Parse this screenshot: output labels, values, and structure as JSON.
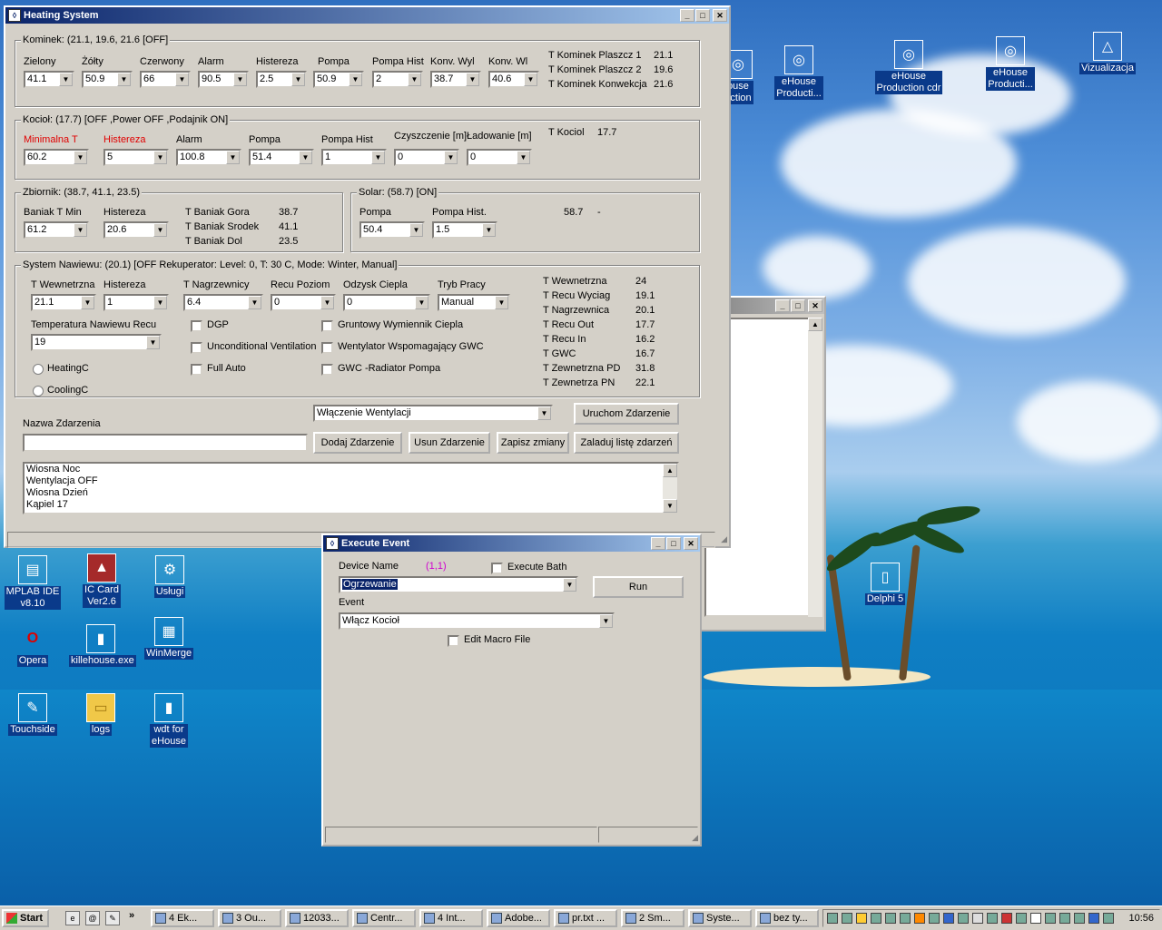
{
  "desktop_icons": [
    {
      "label": "ouse\nuction",
      "glyph": "◎"
    },
    {
      "label": "eHouse\nProducti...",
      "glyph": "◎"
    },
    {
      "label": "eHouse\nProduction cdr",
      "glyph": "◎"
    },
    {
      "label": "eHouse\nProducti...",
      "glyph": "◎"
    },
    {
      "label": "Vizualizacja",
      "glyph": "△"
    },
    {
      "label": "MPLAB IDE\nv8.10",
      "glyph": "▤"
    },
    {
      "label": "IC Card\nVer2.6",
      "glyph": "▲"
    },
    {
      "label": "Usługi",
      "glyph": "⚙"
    },
    {
      "label": "Opera",
      "glyph": "O"
    },
    {
      "label": "killehouse.exe",
      "glyph": "▮"
    },
    {
      "label": "WinMerge",
      "glyph": "▦"
    },
    {
      "label": "Touchside",
      "glyph": "✎"
    },
    {
      "label": "logs",
      "glyph": "▭"
    },
    {
      "label": "wdt for\neHouse",
      "glyph": "▮"
    },
    {
      "label": "Delphi 5",
      "glyph": "▯"
    }
  ],
  "heating": {
    "title": "Heating System",
    "kominek": {
      "group": "Kominek: (21.1, 19.6, 21.6 [OFF]",
      "fields": [
        {
          "label": "Zielony",
          "value": "41.1"
        },
        {
          "label": "Żółty",
          "value": "50.9"
        },
        {
          "label": "Czerwony",
          "value": "66"
        },
        {
          "label": "Alarm",
          "value": "90.5"
        },
        {
          "label": "Histereza",
          "value": "2.5"
        },
        {
          "label": "Pompa",
          "value": "50.9"
        },
        {
          "label": "Pompa Hist",
          "value": "2"
        },
        {
          "label": "Konv. Wyl",
          "value": "38.7"
        },
        {
          "label": "Konv. Wl",
          "value": "40.6"
        }
      ],
      "readouts": [
        {
          "label": "T Kominek Plaszcz 1",
          "value": "21.1"
        },
        {
          "label": "T Kominek Plaszcz 2",
          "value": "19.6"
        },
        {
          "label": "T Kominek Konwekcja",
          "value": "21.6"
        }
      ]
    },
    "kociol": {
      "group": "Kocioł: (17.7) [OFF ,Power OFF ,Podajnik ON]",
      "fields": [
        {
          "label": "Minimalna T",
          "value": "60.2"
        },
        {
          "label": "Histereza",
          "value": "5"
        },
        {
          "label": "Alarm",
          "value": "100.8"
        },
        {
          "label": "Pompa",
          "value": "51.4"
        },
        {
          "label": "Pompa Hist",
          "value": "1"
        },
        {
          "label": "Czyszczenie [m]",
          "value": "0"
        },
        {
          "label": "Ładowanie [m]",
          "value": "0"
        }
      ],
      "readout_label": "T Kociol",
      "readout_value": "17.7"
    },
    "zbiornik": {
      "group": "Zbiornik: (38.7, 41.1, 23.5)",
      "fields": [
        {
          "label": "Baniak T Min",
          "value": "61.2"
        },
        {
          "label": "Histereza",
          "value": "20.6"
        }
      ],
      "readouts": [
        {
          "label": "T Baniak Gora",
          "value": "38.7"
        },
        {
          "label": "T Baniak Srodek",
          "value": "41.1"
        },
        {
          "label": "T Baniak Dol",
          "value": "23.5"
        }
      ]
    },
    "solar": {
      "group": "Solar: (58.7) [ON]",
      "fields": [
        {
          "label": "Pompa",
          "value": "50.4"
        },
        {
          "label": "Pompa Hist.",
          "value": "1.5"
        }
      ],
      "readout_value": "58.7",
      "readout_extra": "-"
    },
    "nawiew": {
      "group": "System Nawiewu: (20.1) [OFF Rekuperator: Level: 0, T: 30 C, Mode: Winter, Manual]",
      "fields": [
        {
          "label": "T Wewnetrzna",
          "value": "21.1"
        },
        {
          "label": "Histereza",
          "value": "1"
        },
        {
          "label": "T Nagrzewnicy",
          "value": "6.4"
        },
        {
          "label": "Recu Poziom",
          "value": "0"
        },
        {
          "label": "Odzysk Ciepla",
          "value": "0"
        },
        {
          "label": "Tryb Pracy",
          "value": "Manual"
        }
      ],
      "recu_label": "Temperatura Nawiewu Recu",
      "recu_value": "19",
      "checks": [
        "DGP",
        "Unconditional Ventilation",
        "Full Auto",
        "Gruntowy Wymiennik Ciepla",
        "Wentylator Wspomagający GWC",
        "GWC -Radiator Pompa"
      ],
      "radios": [
        "HeatingC",
        "CoolingC"
      ],
      "readouts": [
        {
          "label": "T Wewnetrzna",
          "value": "24"
        },
        {
          "label": "T Recu Wyciag",
          "value": "19.1"
        },
        {
          "label": "T Nagrzewnica",
          "value": "20.1"
        },
        {
          "label": "T Recu Out",
          "value": "17.7"
        },
        {
          "label": "T Recu In",
          "value": "16.2"
        },
        {
          "label": "T GWC",
          "value": "16.7"
        },
        {
          "label": "T Zewnetrzna PD",
          "value": "31.8"
        },
        {
          "label": "T Zewnetrza PN",
          "value": "22.1"
        }
      ]
    },
    "events": {
      "combo_value": "Włączenie Wentylacji",
      "run_button": "Uruchom Zdarzenie",
      "name_label": "Nazwa Zdarzenia",
      "name_value": "",
      "add_button": "Dodaj Zdarzenie",
      "remove_button": "Usun Zdarzenie",
      "save_button": "Zapisz zmiany",
      "load_button": "Zaladuj listę zdarzeń",
      "list": [
        "Wiosna Noc",
        "Wentylacja OFF",
        "Wiosna Dzień",
        "Kąpiel 17"
      ]
    }
  },
  "execute": {
    "title": "Execute Event",
    "device_label": "Device Name",
    "device_id": "(1,1)",
    "execute_bath": "Execute Bath",
    "device_value": "Ogrzewanie",
    "run_button": "Run",
    "event_label": "Event",
    "event_value": "Włącz Kocioł",
    "edit_macro": "Edit Macro File"
  },
  "taskbar": {
    "start": "Start",
    "tasks": [
      "4 Ek...",
      "3 Ou...",
      "12033...",
      "Centr...",
      "4 Int...",
      "Adobe...",
      "pr.txt ...",
      "2 Sm...",
      "Syste...",
      "bez ty..."
    ],
    "clock": "10:56"
  }
}
